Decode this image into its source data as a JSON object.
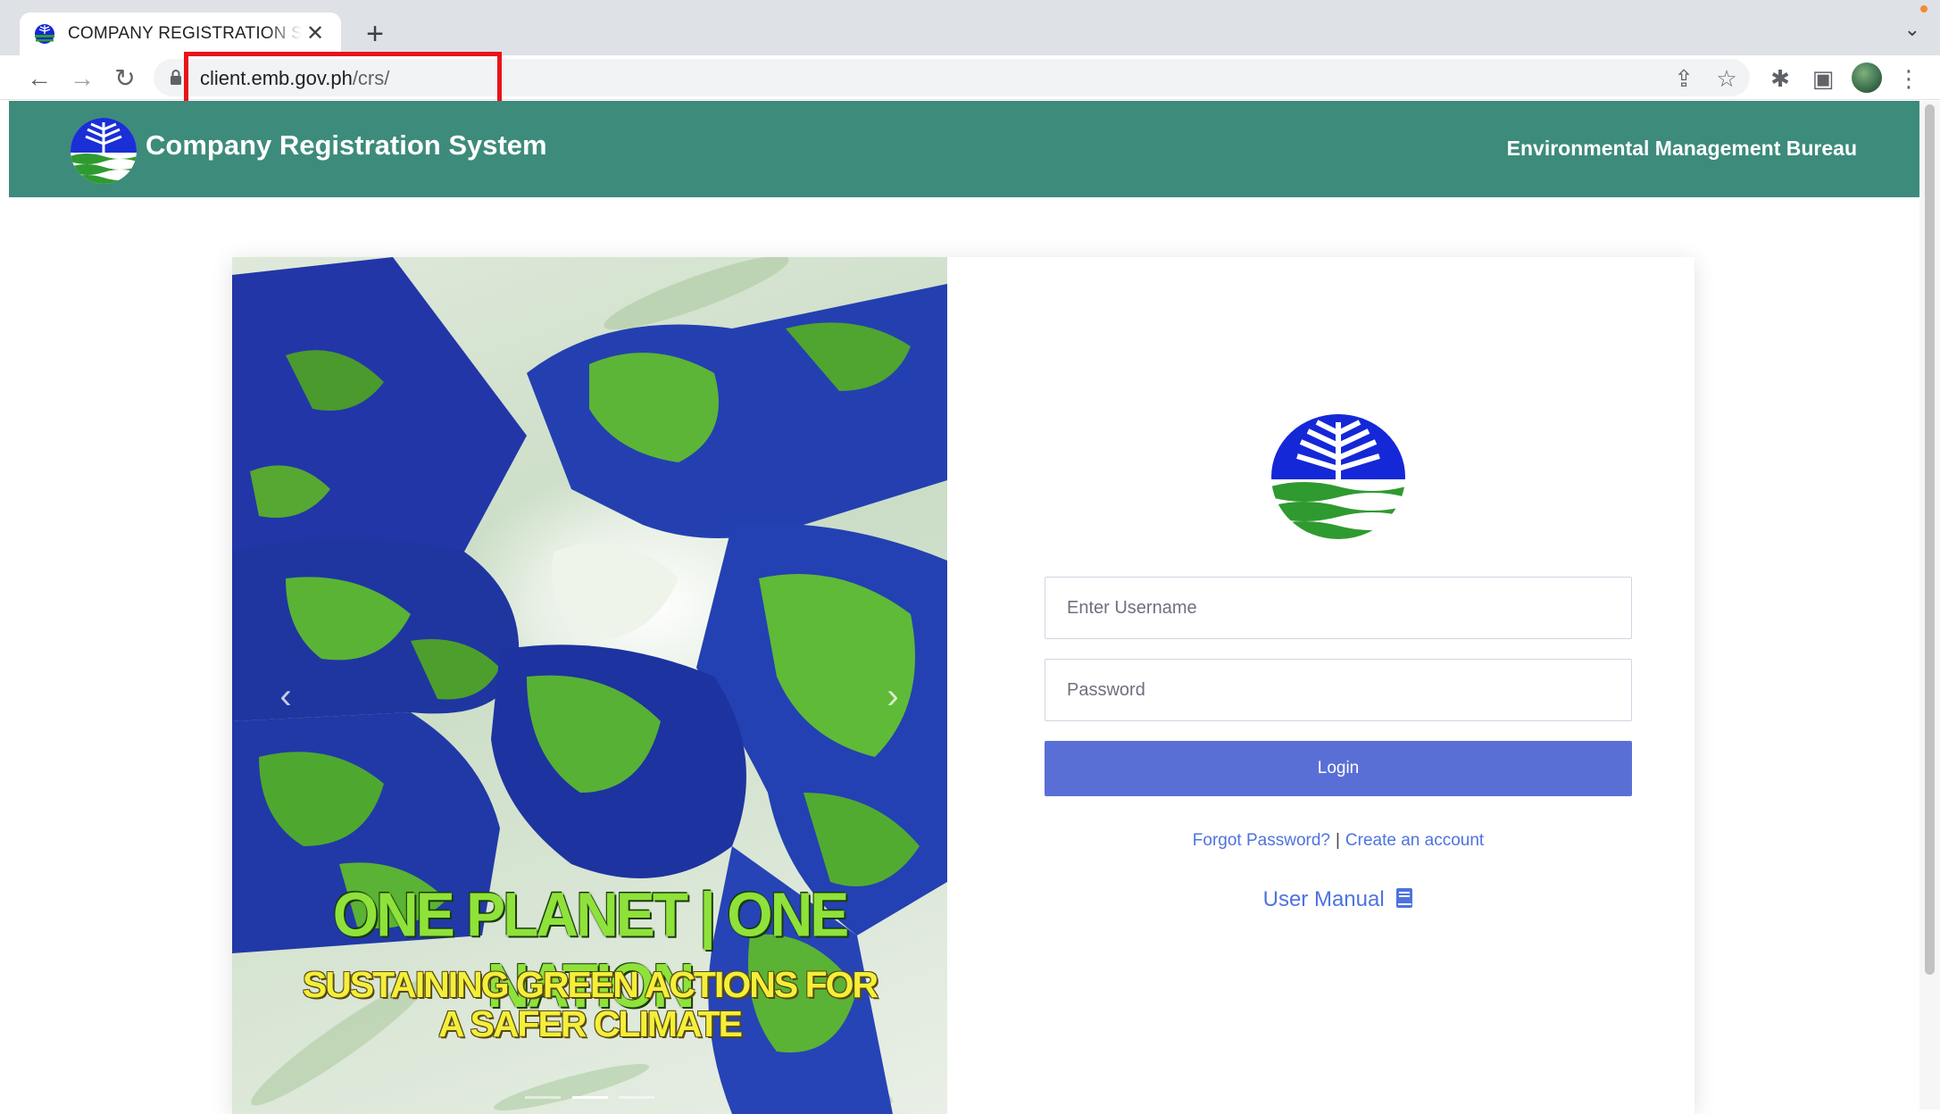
{
  "browser": {
    "tab_title": "COMPANY REGISTRATION SYSTEM",
    "new_tab_icon": "plus-icon",
    "url_host": "client.emb.gov.ph",
    "url_path": "/crs/"
  },
  "header": {
    "title": "Company Registration System",
    "agency": "Environmental Management Bureau"
  },
  "carousel": {
    "line1": "ONE PLANET | ONE NATION",
    "line2": "SUSTAINING GREEN ACTIONS FOR",
    "line3": "A SAFER CLIMATE",
    "prev_icon": "chevron-left-icon",
    "next_icon": "chevron-right-icon"
  },
  "login": {
    "username_placeholder": "Enter Username",
    "password_placeholder": "Password",
    "login_label": "Login",
    "forgot_label": "Forgot Password?",
    "separator": "|",
    "create_label": "Create an account",
    "manual_label": "User Manual"
  },
  "colors": {
    "header_bg": "#3d8b7b",
    "button_bg": "#5a6fd6",
    "link": "#4e73df",
    "highlight": "#e8141a"
  }
}
